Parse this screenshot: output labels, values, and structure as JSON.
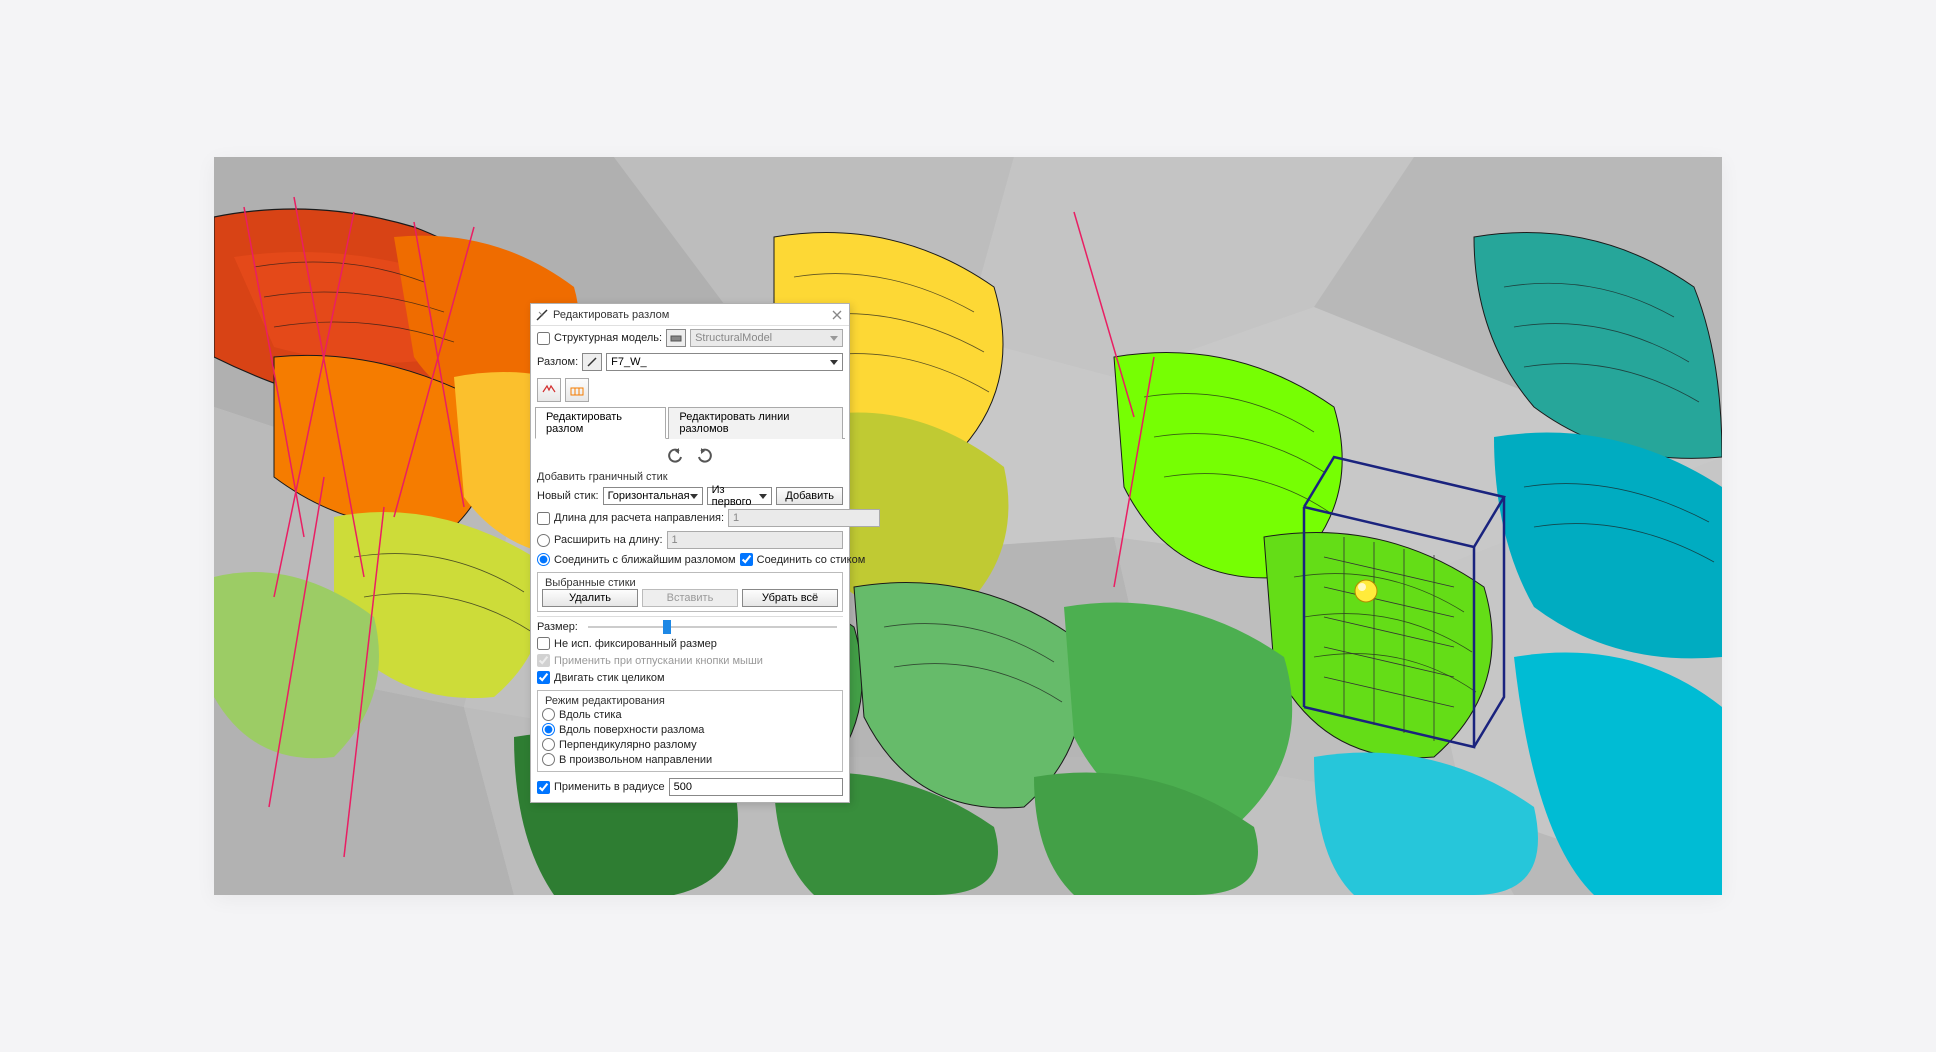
{
  "dialog": {
    "title": "Редактировать разлом",
    "struct_model_label": "Структурная модель:",
    "struct_model_value": "StructuralModel",
    "fault_label": "Разлом:",
    "fault_value": "F7_W_",
    "tabs": {
      "edit_fault": "Редактировать разлом",
      "edit_lines": "Редактировать линии разломов"
    },
    "add_boundary_stick": "Добавить граничный стик",
    "new_stick_label": "Новый стик:",
    "orientation_value": "Горизонтальная",
    "from_value": "Из первого",
    "add_btn": "Добавить",
    "length_calc_label": "Длина для расчета направления:",
    "length_calc_value": "1",
    "extend_label": "Расширить на длину:",
    "extend_value": "1",
    "connect_fault": "Соединить с ближайшим разломом",
    "connect_stick": "Соединить со стиком",
    "selected_sticks": "Выбранные стики",
    "delete_btn": "Удалить",
    "insert_btn": "Вставить",
    "remove_all_btn": "Убрать всё",
    "size_label": "Размер:",
    "no_fixed_size": "Не исп. фиксированный размер",
    "apply_on_release": "Применить при отпускании кнопки мыши",
    "move_whole_stick": "Двигать стик целиком",
    "edit_mode": "Режим редактирования",
    "mode_along_stick": "Вдоль стика",
    "mode_along_surface": "Вдоль поверхности разлома",
    "mode_perpendicular": "Перпендикулярно разлому",
    "mode_arbitrary": "В произвольном направлении",
    "apply_radius_label": "Применить в радиусе",
    "apply_radius_value": "500"
  }
}
